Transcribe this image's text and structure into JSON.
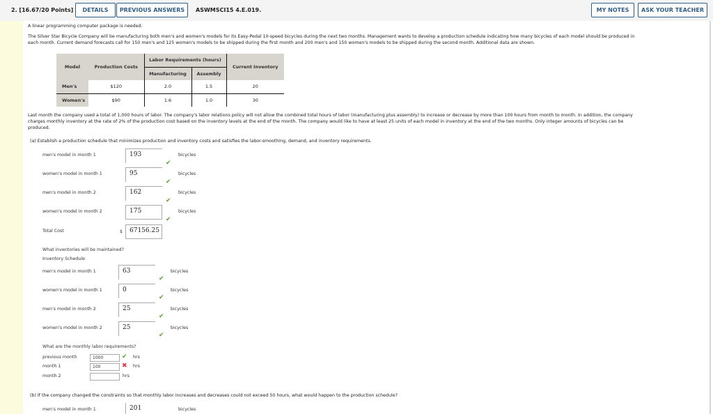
{
  "header": {
    "question_number": "2.",
    "points": "[16.67/20 Points]",
    "details_label": "DETAILS",
    "previous_answers_label": "PREVIOUS ANSWERS",
    "question_code": "ASWMSCI15 4.E.019.",
    "my_notes_label": "MY NOTES",
    "ask_teacher_label": "ASK YOUR TEACHER"
  },
  "intro": {
    "line1": "A linear programming computer package is needed.",
    "para1_line1": "The Silver Star Bicycle Company will be manufacturing both men's and women's models for its Easy-Pedal 10-speed bicycles during the next two months. Management wants to develop a production schedule indicating how many bicycles of each model should be produced in",
    "para1_line2": "each month. Current demand forecasts call for 150 men's and 125 women's models to be shipped during the first month and 200 men's and 150 women's models to be shipped during the second month. Additional data are shown."
  },
  "table": {
    "headers": {
      "model": "Model",
      "production_costs": "Production Costs",
      "labor_requirements": "Labor Requirements (hours)",
      "manufacturing": "Manufacturing",
      "assembly": "Assembly",
      "current_inventory": "Current Inventory"
    },
    "rows": [
      {
        "model": "Men's",
        "cost": "$120",
        "manufacturing": "2.0",
        "assembly": "1.5",
        "inventory": "20"
      },
      {
        "model": "Women's",
        "cost": "$90",
        "manufacturing": "1.6",
        "assembly": "1.0",
        "inventory": "30"
      }
    ]
  },
  "para2": {
    "line1": "Last month the company used a total of 1,000 hours of labor. The company's labor relations policy will not allow the combined total hours of labor (manufacturing plus assembly) to increase or decrease by more than 100 hours from month to month. In addition, the company",
    "line2": "charges monthly inventory at the rate of 2% of the production cost based on the inventory levels at the end of the month. The company would like to have at least 25 units of each model in inventory at the end of the two months. Only integer amounts of bicycles can be",
    "line3": "produced."
  },
  "part_a": {
    "prompt": "(a)   Establish a production schedule that minimizes production and inventory costs and satisfies the labor-smoothing, demand, and inventory requirements.",
    "production": [
      {
        "label": "men's model in month 1",
        "value": "193",
        "unit": "bicycles",
        "status": "correct"
      },
      {
        "label": "women's model in month 1",
        "value": "95",
        "unit": "bicycles",
        "status": "correct"
      },
      {
        "label": "men's model in month 2",
        "value": "162",
        "unit": "bicycles",
        "status": "correct"
      },
      {
        "label": "women's model in month 2",
        "value": "175",
        "unit": "bicycles",
        "status": "correct"
      }
    ],
    "total_cost": {
      "label": "Total Cost",
      "currency": "$",
      "value": "67156.25"
    },
    "inventory_question": "What inventories will be maintained?",
    "inventory_heading": "Inventory Schedule",
    "inventory": [
      {
        "label": "men's model in month 1",
        "value": "63",
        "unit": "bicycles",
        "status": "correct"
      },
      {
        "label": "women's model in month 1",
        "value": "0",
        "unit": "bicycles",
        "status": "correct"
      },
      {
        "label": "men's model in month 2",
        "value": "25",
        "unit": "bicycles",
        "status": "correct"
      },
      {
        "label": "women's model in month 2",
        "value": "25",
        "unit": "bicycles",
        "status": "correct"
      }
    ],
    "labor_question": "What are the monthly labor requirements?",
    "labor": [
      {
        "label": "previous month",
        "value": "1000",
        "unit": "hrs",
        "status": "correct"
      },
      {
        "label": "month 1",
        "value": "100",
        "unit": "hrs",
        "status": "incorrect"
      },
      {
        "label": "month 2",
        "value": "",
        "unit": "hrs",
        "status": "none"
      }
    ]
  },
  "part_b": {
    "prompt": "(b)   If the company changed the constraints so that monthly labor increases and decreases could not exceed 50 hours, what would happen to the production schedule?",
    "rows": [
      {
        "label": "men's model in month 1",
        "value": "201",
        "unit": "bicycles"
      }
    ]
  },
  "icons": {
    "check": "✔",
    "cross": "✖"
  }
}
